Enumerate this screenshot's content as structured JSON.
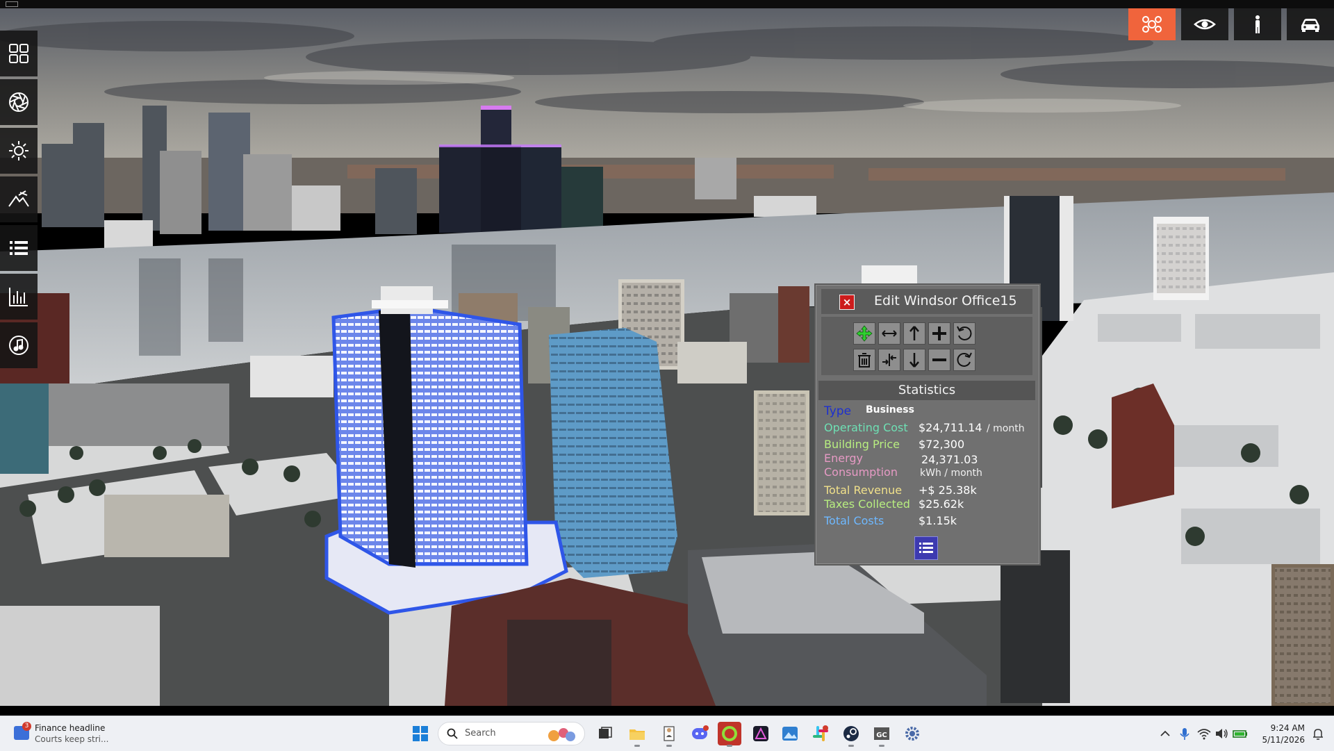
{
  "camera_modes": [
    {
      "icon": "overview-drone-icon",
      "active": true
    },
    {
      "icon": "eye-icon",
      "active": false
    },
    {
      "icon": "person-icon",
      "active": false
    },
    {
      "icon": "car-icon",
      "active": false
    }
  ],
  "left_toolbar": [
    {
      "icon": "grid-menu-icon"
    },
    {
      "icon": "aperture-icon"
    },
    {
      "icon": "sun-icon"
    },
    {
      "icon": "terrain-icon"
    },
    {
      "icon": "list-icon"
    },
    {
      "icon": "bar-chart-icon"
    },
    {
      "icon": "music-note-icon"
    }
  ],
  "edit_panel": {
    "title": "Edit Windsor Office15",
    "close_label": "×",
    "statistics_header": "Statistics",
    "type_label": "Type",
    "type_value": "Business",
    "operating_cost_label": "Operating Cost",
    "operating_cost_value": "$24,711.14",
    "operating_cost_unit": "/ month",
    "building_price_label": "Building Price",
    "building_price_value": "$72,300",
    "energy_label_1": "Energy",
    "energy_label_2": "Consumption",
    "energy_value": "24,371.03",
    "energy_unit": "kWh / month",
    "total_revenue_label": "Total Revenue",
    "total_revenue_value": "+$ 25.38k",
    "taxes_label": "Taxes Collected",
    "taxes_value": "$25.62k",
    "total_costs_label": "Total Costs",
    "total_costs_value": "$1.15k",
    "colors": {
      "type": "#1c2fd0",
      "operating_cost": "#6ee0b4",
      "building_price": "#b8ee80",
      "energy": "#e69ac4",
      "revenue": "#f0e08a",
      "taxes": "#b8ee80",
      "total_costs": "#6eb8ff"
    }
  },
  "taskbar": {
    "news_title": "Finance headline",
    "news_subtitle": "Courts keep stri...",
    "news_badge": "3",
    "search_placeholder": "Search",
    "clock_time": "9:24 AM",
    "clock_date": "5/11/2026"
  }
}
